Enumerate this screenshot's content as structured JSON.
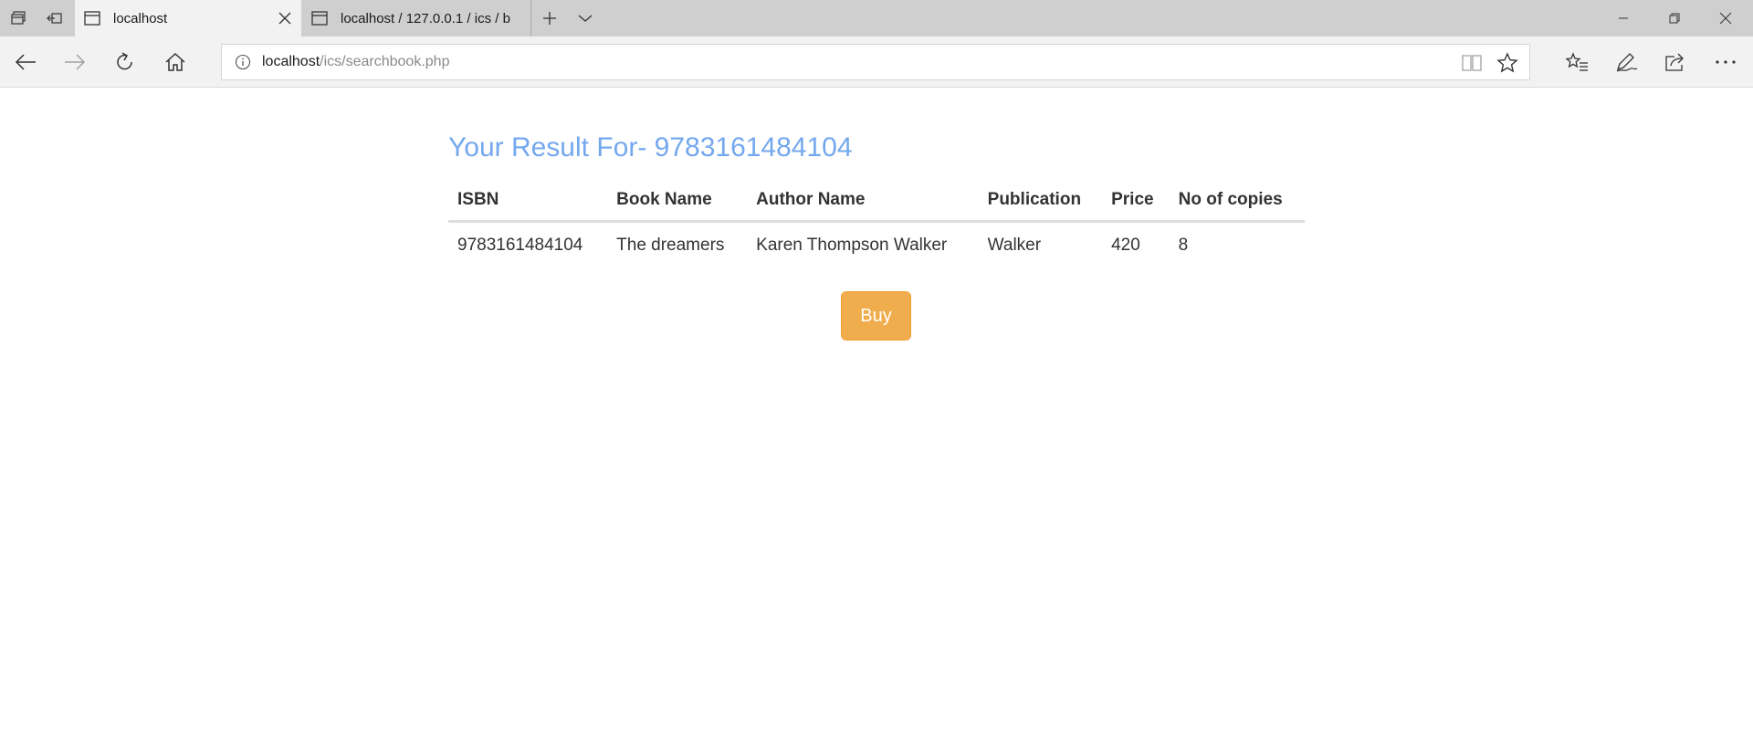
{
  "browser": {
    "tabs": [
      {
        "title": "localhost",
        "active": true
      },
      {
        "title": "localhost / 127.0.0.1 / ics / b",
        "active": false
      }
    ],
    "address": {
      "host": "localhost",
      "path": "/ics/searchbook.php"
    }
  },
  "page": {
    "heading": "Your Result For- 9783161484104",
    "table": {
      "columns": [
        "ISBN",
        "Book Name",
        "Author Name",
        "Publication",
        "Price",
        "No of copies"
      ],
      "rows": [
        [
          "9783161484104",
          "The dreamers",
          "Karen Thompson Walker",
          "Walker",
          "420",
          "8"
        ]
      ]
    },
    "buy_label": "Buy"
  },
  "colors": {
    "heading": "#74a8ee",
    "buy_button": "#f0ad4e",
    "tab_bar": "#cfcfcf",
    "toolbar": "#f2f2f2"
  }
}
